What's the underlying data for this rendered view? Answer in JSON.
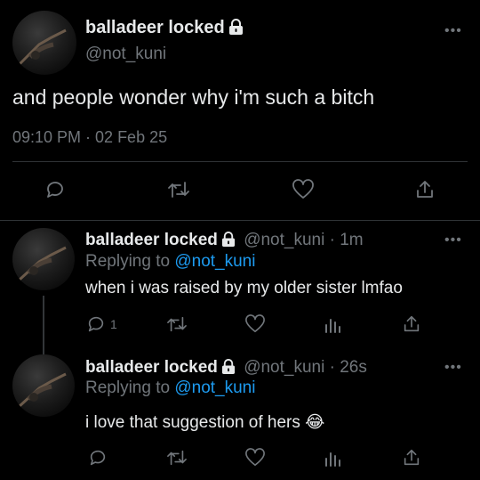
{
  "colors": {
    "background": "#000000",
    "text": "#e7e9ea",
    "muted": "#71767b",
    "link": "#1d9bf0",
    "separator": "#2f3336"
  },
  "main_tweet": {
    "display_name": "balladeer locked",
    "handle": "@not_kuni",
    "text": "and people wonder why i'm such a bitch",
    "timestamp": "09:10 PM · 02 Feb 25",
    "more": "•••",
    "actions": [
      "reply-icon",
      "retweet-icon",
      "like-icon",
      "share-icon"
    ]
  },
  "replies": [
    {
      "display_name": "balladeer locked",
      "handle": "@not_kuni",
      "time": "· 1m",
      "replying_label": "Replying to",
      "replying_handle": "@not_kuni",
      "text": "when i was raised by my older sister lmfao",
      "reply_count": "1",
      "more": "•••",
      "actions": [
        "reply-icon",
        "retweet-icon",
        "like-icon",
        "analytics-icon",
        "share-icon"
      ]
    },
    {
      "display_name": "balladeer locked",
      "handle": "@not_kuni",
      "time": "· 26s",
      "replying_label": "Replying to",
      "replying_handle": "@not_kuni",
      "text": "i love that suggestion of hers 😂",
      "reply_count": "",
      "more": "•••",
      "actions": [
        "reply-icon",
        "retweet-icon",
        "like-icon",
        "analytics-icon",
        "share-icon"
      ]
    }
  ]
}
